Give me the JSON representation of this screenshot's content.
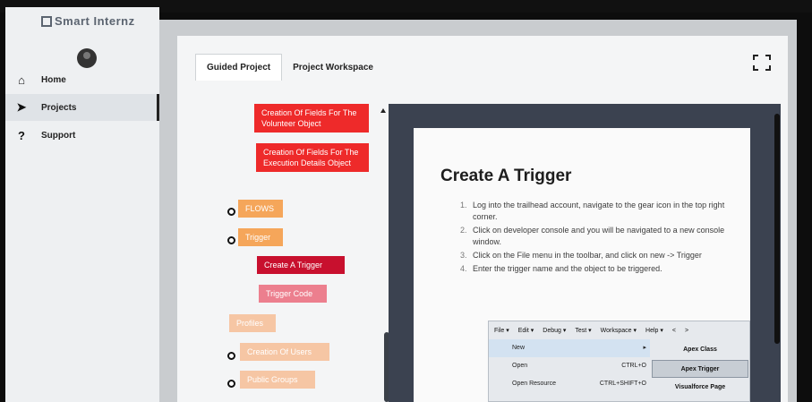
{
  "app": {
    "logo_text": "Smart Internz"
  },
  "sidebar": {
    "items": [
      {
        "label": "Home",
        "icon": "home-icon"
      },
      {
        "label": "Projects",
        "icon": "send-icon"
      },
      {
        "label": "Support",
        "icon": "question-icon"
      }
    ],
    "active": "Projects"
  },
  "tabs": [
    {
      "label": "Guided Project"
    },
    {
      "label": "Project Workspace"
    }
  ],
  "tree": {
    "creation_fields_volunteer": "Creation Of Fields For The Volunteer Object",
    "creation_fields_execution": "Creation Of Fields For The Execution Details Object",
    "flows": "FLOWS",
    "trigger": "Trigger",
    "create_a_trigger": "Create A Trigger",
    "trigger_code": "Trigger Code",
    "profiles": "Profiles",
    "creation_of_users": "Creation Of Users",
    "public_groups": "Public Groups"
  },
  "content": {
    "title": "Create A Trigger",
    "steps": [
      "Log into the trailhead account, navigate to the gear icon in the top right corner.",
      "Click on developer console and you will be navigated to a new console window.",
      "Click on the File menu in the toolbar, and click on new -> Trigger",
      "Enter the trigger name and the object to be triggered."
    ]
  },
  "screenshot": {
    "menus": [
      "File ▾",
      "Edit ▾",
      "Debug ▾",
      "Test ▾",
      "Workspace ▾",
      "Help ▾",
      "<",
      ">"
    ],
    "rows": [
      {
        "label": "New",
        "shortcut": "▸"
      },
      {
        "label": "Open",
        "shortcut": "CTRL+O"
      },
      {
        "label": "Open Resource",
        "shortcut": "CTRL+SHIFT+O"
      }
    ],
    "options": [
      "Apex Class",
      "Apex Trigger",
      "Visualforce Page"
    ]
  }
}
